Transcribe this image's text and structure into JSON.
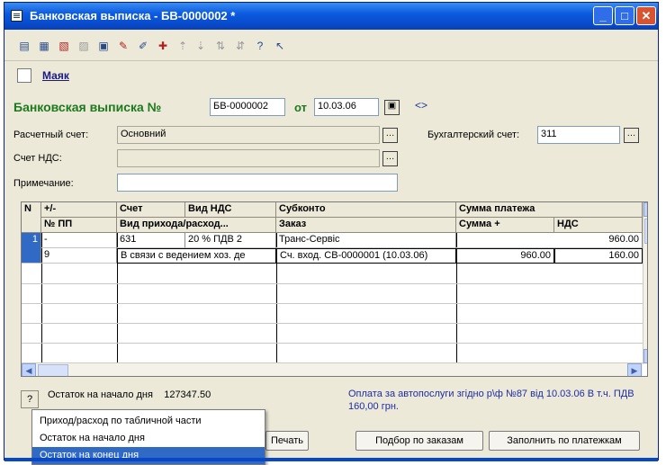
{
  "window": {
    "title": "Банковская выписка - БВ-0000002 *"
  },
  "toolbar": {
    "icons": [
      "new-row-icon",
      "copy-row-icon",
      "edit-row-icon",
      "delete-row-icon",
      "doc-icon",
      "mark-icon",
      "edit-icon",
      "plus-icon",
      "up-arrow-icon",
      "down-arrow-icon",
      "sort-asc-icon",
      "sort-desc-icon",
      "help-icon",
      "context-help-icon"
    ]
  },
  "header": {
    "organization": "Маяк"
  },
  "document": {
    "title": "Банковская выписка №",
    "number": "БВ-0000002",
    "date_label": "от",
    "date": "10.03.06",
    "link_symbol": "<>"
  },
  "form": {
    "account_label": "Расчетный счет:",
    "account_value": "Основний",
    "accounting_label": "Бухгалтерский счет:",
    "accounting_value": "311",
    "vat_label": "Счет НДС:",
    "vat_value": "",
    "note_label": "Примечание:",
    "note_value": ""
  },
  "table": {
    "headers": {
      "n": "N",
      "pm": "+/-",
      "pp": "№ ПП",
      "account": "Счет",
      "vat_type": "Вид НДС",
      "flow_type": "Вид прихода/расход...",
      "subconto": "Субконто",
      "order": "Заказ",
      "payment_sum": "Сумма платежа",
      "sum_plus": "Сумма +",
      "vat": "НДС"
    },
    "rows": [
      {
        "n": "1",
        "pm": "-",
        "pp": "9",
        "account": "631",
        "vat_type": "20 % ПДВ 2",
        "flow_type": "В связи с ведением хоз. де",
        "subconto": "Транс-Сервіс",
        "order": "Сч. вход. СВ-0000001 (10.03.06)",
        "sum": "960.00",
        "sum_plus": "960.00",
        "vat": "160.00"
      }
    ]
  },
  "footer": {
    "help": "?",
    "balance_label": "Остаток на начало дня",
    "balance_value": "127347.50",
    "note": "Оплата за автопослуги згідно р\\ф №87 від 10.03.06 В т.ч. ПДВ 160,00 грн.",
    "menu": [
      "Приход/расход по табличной части",
      "Остаток на начало дня",
      "Остаток на конец дня"
    ],
    "selected_menu_index": 2,
    "buttons": {
      "print": "Печать",
      "select_orders": "Подбор по заказам",
      "fill_payments": "Заполнить по платежкам"
    }
  }
}
